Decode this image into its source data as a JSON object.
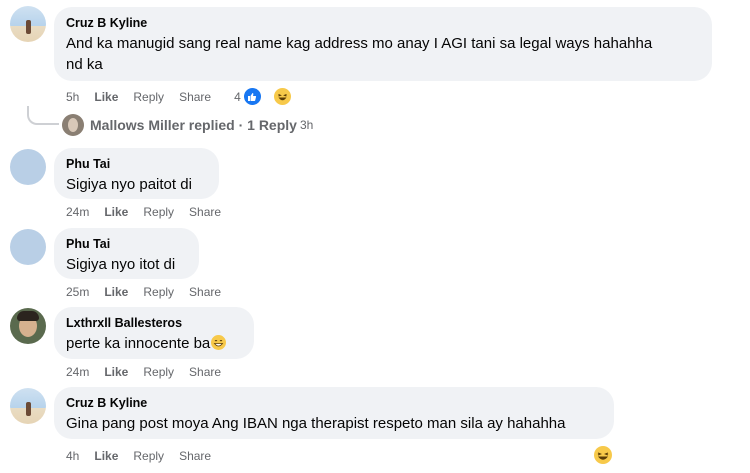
{
  "comments": [
    {
      "author": "Cruz B Kyline",
      "text_line1": "And ka manugid sang real name kag address mo anay I AGI tani sa legal ways hahahha",
      "text_line2": "nd ka",
      "time": "5h",
      "like": "Like",
      "reply": "Reply",
      "share": "Share",
      "reaction_count": "4",
      "reactions": [
        "like-icon",
        "haha-icon"
      ]
    },
    {
      "author": "Phu Tai",
      "text": "Sigiya nyo paitot di",
      "time": "24m",
      "like": "Like",
      "reply": "Reply",
      "share": "Share"
    },
    {
      "author": "Phu Tai",
      "text": "Sigiya nyo itot di",
      "time": "25m",
      "like": "Like",
      "reply": "Reply",
      "share": "Share"
    },
    {
      "author": "Lxthrxll Ballesteros",
      "text": "perte ka innocente ba",
      "time": "24m",
      "like": "Like",
      "reply": "Reply",
      "share": "Share"
    },
    {
      "author": "Cruz B Kyline",
      "text": "Gina pang post moya Ang IBAN nga therapist respeto man sila ay hahahha",
      "time": "4h",
      "like": "Like",
      "reply": "Reply",
      "share": "Share"
    }
  ],
  "reply_summary": {
    "text": "Mallows Miller replied · 1 Reply",
    "time": "3h"
  }
}
